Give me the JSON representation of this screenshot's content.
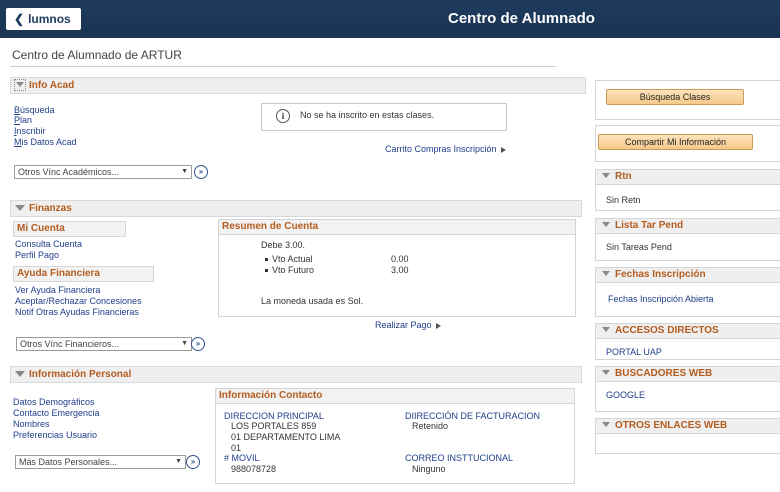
{
  "header": {
    "back_label": "lumnos",
    "title": "Centro de Alumnado"
  },
  "page_subtitle": "Centro de Alumnado de ARTUR",
  "info_acad": {
    "title": "Info Acad",
    "links": [
      "Búsqueda",
      "Plan",
      "Inscribir",
      "Mis Datos Acad"
    ],
    "notice": "No se ha inscrito en estas clases.",
    "cart_link": "Carrito Compras Inscripción",
    "select_value": "Otros Vínc Académicos..."
  },
  "finanzas": {
    "title": "Finanzas",
    "mi_cuenta_title": "Mi Cuenta",
    "mi_cuenta_links": [
      "Consulta Cuenta",
      "Perfil Pago"
    ],
    "ayuda_title": "Ayuda Financiera",
    "ayuda_links": [
      "Ver Ayuda Financiera",
      "Aceptar/Rechazar Concesiones",
      "Notif Otras Ayudas Financieras"
    ],
    "select_value": "Otros Vínc Financieros...",
    "resumen": {
      "title": "Resumen de Cuenta",
      "debe": "Debe 3.00.",
      "rows": [
        {
          "label": "Vto Actual",
          "value": "0.00"
        },
        {
          "label": "Vto Futuro",
          "value": "3.00"
        }
      ],
      "currency_note": "La moneda usada es Sol.",
      "realizar_pago": "Realizar Pago"
    }
  },
  "info_personal": {
    "title": "Información Personal",
    "links": [
      "Datos Demográficos",
      "Contacto Emergencia",
      "Nombres",
      "Preferencias Usuario"
    ],
    "select_value": "Más Datos Personales...",
    "contacto": {
      "title": "Información Contacto",
      "dir_principal_label": "DIRECCION PRINCIPAL",
      "dir_principal_lines": [
        "LOS PORTALES 859",
        "01 DEPARTAMENTO LIMA",
        "01"
      ],
      "dir_facturacion_label": "DIIRECCIÓN DE FACTURACION",
      "dir_facturacion_value": "Retenido",
      "movil_label": "# MOVIL",
      "movil_value": "988078728",
      "correo_label": "CORREO INSTTUCIONAL",
      "correo_value": "Ninguno"
    }
  },
  "right": {
    "busqueda_btn": "Búsqueda Clases",
    "compartir_btn": "Compartir Mi Información",
    "rtn": {
      "title": "Rtn",
      "value": "Sin Retn"
    },
    "lista": {
      "title": "Lista Tar Pend",
      "value": "Sin Tareas Pend"
    },
    "fechas": {
      "title": "Fechas Inscripción",
      "value": "Fechas Inscripción Abierta"
    },
    "accesos": {
      "title": "ACCESOS DIRECTOS",
      "value": "PORTAL UAP"
    },
    "buscadores": {
      "title": "BUSCADORES WEB",
      "value": "GOOGLE"
    },
    "otros": {
      "title": "OTROS ENLACES WEB"
    }
  },
  "colors": {
    "header_bg": "#1e3b5e",
    "section_title": "#b45c1e",
    "link": "#1f3f8a",
    "button": "#f6c98b"
  }
}
